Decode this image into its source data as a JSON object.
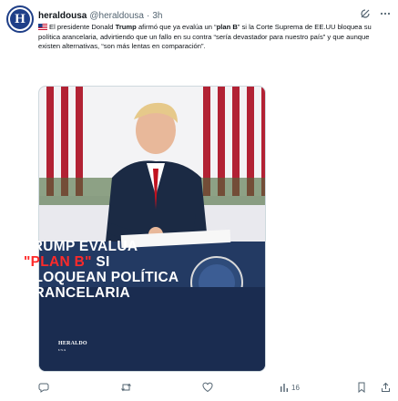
{
  "tweet": {
    "avatar_letter": "H",
    "name": "heraldousa",
    "handle": "@heraldousa",
    "separator": "·",
    "time": "3h",
    "text": {
      "p1": "El presidente Donald ",
      "b1": "Trump",
      "p2": " afirmó que ya evalúa un “",
      "b2": "plan B",
      "p3": "” si la Corte Suprema de EE.UU bloquea su política arancelaria, advirtiendo que un fallo en su contra “sería devastador para nuestro país” y que aunque existen alternativas, “son más lentas en comparación”."
    },
    "media": {
      "headline_line1": "TRUMP EVALUA",
      "headline_planb": "\"PLAN B\"",
      "headline_si": " SI",
      "headline_line3": "BLOQUEAN POLÍTICA",
      "headline_line4": "ARANCELARIA",
      "logo_text": "HERALDO",
      "logo_sub": "USA"
    },
    "actions": {
      "views": "16"
    },
    "icons": [
      "grok-icon",
      "more-icon",
      "reply-icon",
      "retweet-icon",
      "like-icon",
      "views-icon",
      "bookmark-icon",
      "share-icon"
    ]
  },
  "colors": {
    "brand": "#1f3f88",
    "accent": "#ff2a2a",
    "muted": "#536471"
  }
}
